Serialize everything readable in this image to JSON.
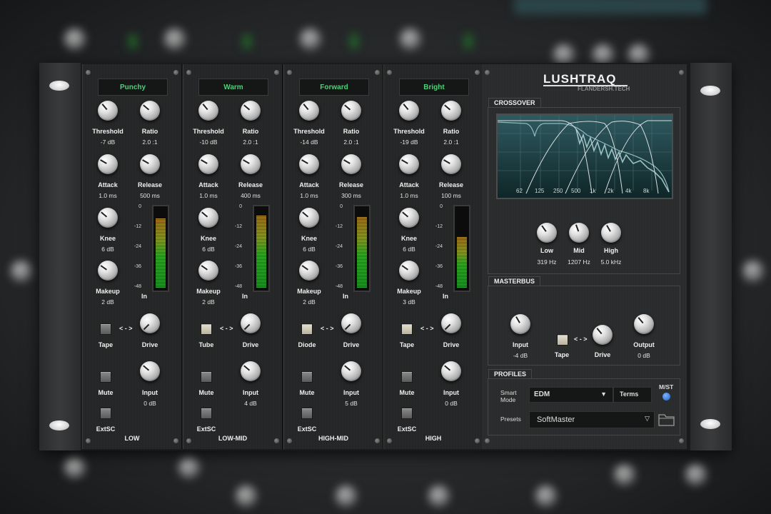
{
  "brand": {
    "title": "LUSHTRAQ",
    "subtitle": "FLANDERSH.TECH"
  },
  "bands": [
    {
      "preset": "Punchy",
      "threshold_label": "Threshold",
      "threshold": "-7 dB",
      "ratio_label": "Ratio",
      "ratio": "2.0 :1",
      "attack_label": "Attack",
      "attack": "1.0 ms",
      "release_label": "Release",
      "release": "500 ms",
      "knee_label": "Knee",
      "knee": "6 dB",
      "makeup_label": "Makeup",
      "makeup": "2 dB",
      "in_label": "In",
      "mode_label": "Tape",
      "arrow": "< - >",
      "drive_label": "Drive",
      "mute_label": "Mute",
      "input_label": "Input",
      "input": "0 dB",
      "extsc_label": "ExtSC",
      "name": "LOW",
      "meter_level": 0.82
    },
    {
      "preset": "Warm",
      "threshold_label": "Threshold",
      "threshold": "-10 dB",
      "ratio_label": "Ratio",
      "ratio": "2.0 :1",
      "attack_label": "Attack",
      "attack": "1.0 ms",
      "release_label": "Release",
      "release": "400 ms",
      "knee_label": "Knee",
      "knee": "6 dB",
      "makeup_label": "Makeup",
      "makeup": "2 dB",
      "in_label": "In",
      "mode_label": "Tube",
      "arrow": "< - >",
      "drive_label": "Drive",
      "mute_label": "Mute",
      "input_label": "Input",
      "input": "4 dB",
      "extsc_label": "ExtSC",
      "name": "LOW-MID",
      "meter_level": 0.86
    },
    {
      "preset": "Forward",
      "threshold_label": "Threshold",
      "threshold": "-14 dB",
      "ratio_label": "Ratio",
      "ratio": "2.0 :1",
      "attack_label": "Attack",
      "attack": "1.0 ms",
      "release_label": "Release",
      "release": "300 ms",
      "knee_label": "Knee",
      "knee": "6 dB",
      "makeup_label": "Makeup",
      "makeup": "2 dB",
      "in_label": "In",
      "mode_label": "Diode",
      "arrow": "< - >",
      "drive_label": "Drive",
      "mute_label": "Mute",
      "input_label": "Input",
      "input": "5 dB",
      "extsc_label": "ExtSC",
      "name": "HIGH-MID",
      "meter_level": 0.84
    },
    {
      "preset": "Bright",
      "threshold_label": "Threshold",
      "threshold": "-19 dB",
      "ratio_label": "Ratio",
      "ratio": "2.0 :1",
      "attack_label": "Attack",
      "attack": "1.0 ms",
      "release_label": "Release",
      "release": "100 ms",
      "knee_label": "Knee",
      "knee": "6 dB",
      "makeup_label": "Makeup",
      "makeup": "3 dB",
      "in_label": "In",
      "mode_label": "Tape",
      "arrow": "< - >",
      "drive_label": "Drive",
      "mute_label": "Mute",
      "input_label": "Input",
      "input": "0 dB",
      "extsc_label": "ExtSC",
      "name": "HIGH",
      "meter_level": 0.6
    }
  ],
  "meter_scale": [
    "0",
    "-12",
    "-24",
    "-36",
    "-48"
  ],
  "crossover": {
    "title": "CROSSOVER",
    "freq_ticks": [
      "62",
      "125",
      "250",
      "500",
      "1k",
      "2k",
      "4k",
      "8k"
    ],
    "low_label": "Low",
    "low": "319 Hz",
    "mid_label": "Mid",
    "mid": "1207 Hz",
    "high_label": "High",
    "high": "5.0 kHz"
  },
  "masterbus": {
    "title": "MASTERBUS",
    "input_label": "Input",
    "input": "-4 dB",
    "tape_label": "Tape",
    "arrow": "< - >",
    "drive_label": "Drive",
    "output_label": "Output",
    "output": "0 dB"
  },
  "profiles": {
    "title": "PROFILES",
    "smart_mode_label_1": "Smart",
    "smart_mode_label_2": "Mode",
    "smart_mode_value": "EDM",
    "dropdown_arrow": "▼",
    "terms_label": "Terms",
    "mst_label": "M/ST",
    "presets_label": "Presets",
    "preset_value": "SoftMaster",
    "preset_arrow": "▽"
  }
}
